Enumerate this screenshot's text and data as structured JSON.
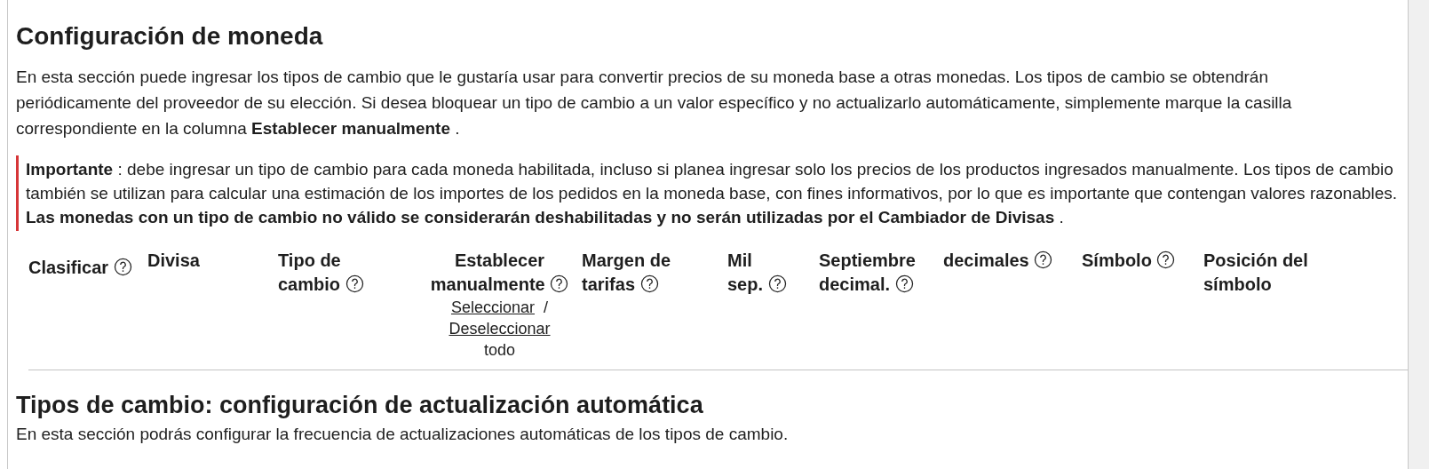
{
  "title": "Configuración de moneda",
  "intro": "En esta sección puede ingresar los tipos de cambio que le gustaría usar para convertir precios de su moneda base a otras monedas. Los tipos de cambio se obtendrán periódicamente del proveedor de su elección. Si desea bloquear un tipo de cambio a un valor específico y no actualizarlo automáticamente, simplemente marque la casilla correspondiente en la columna **Establecer manualmente** .",
  "notice": "**Importante** : debe ingresar un tipo de cambio para cada moneda habilitada, incluso si planea ingresar solo los precios de los productos ingresados manualmente. Los tipos de cambio también se utilizan para calcular una estimación de los importes de los pedidos en la moneda base, con fines informativos, por lo que es importante que contengan valores razonables. **Las monedas con un tipo de cambio no válido se considerarán deshabilitadas y no serán utilizadas por el Cambiador de Divisas** .",
  "table": {
    "columns": [
      {
        "label": "Clasificar",
        "help": true,
        "kind": "plain"
      },
      {
        "label": "Divisa",
        "help": false,
        "kind": "plain"
      },
      {
        "label": "Tipo de cambio",
        "help": true,
        "kind": "plain"
      },
      {
        "label": "Establecer manualmente",
        "help": true,
        "kind": "toggle-all",
        "select": "Seleccionar",
        "separator": "/",
        "deselect": "Deseleccionar",
        "suffix": "todo"
      },
      {
        "label": "Margen de tarifas",
        "help": true,
        "kind": "plain"
      },
      {
        "label": "Mil sep.",
        "help": true,
        "kind": "plain"
      },
      {
        "label": "Septiembre decimal.",
        "help": true,
        "kind": "plain"
      },
      {
        "label": "decimales",
        "help": true,
        "kind": "plain"
      },
      {
        "label": "Símbolo",
        "help": true,
        "kind": "plain"
      },
      {
        "label": "Posición del símbolo",
        "help": false,
        "kind": "plain"
      }
    ]
  },
  "auto_update": {
    "title": "Tipos de cambio: configuración de actualización automática",
    "description": "En esta sección podrás configurar la frecuencia de actualizaciones automáticas de los tipos de cambio."
  }
}
